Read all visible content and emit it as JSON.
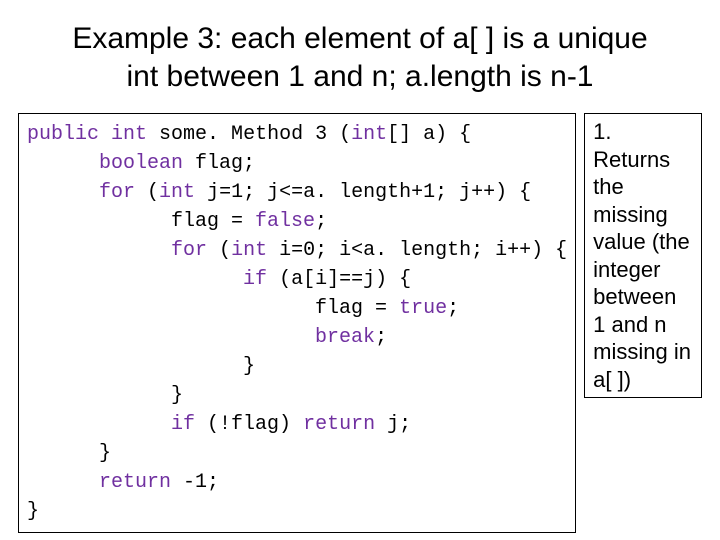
{
  "title_line1": "Example 3: each element of a[ ] is a unique",
  "title_line2": "int between 1 and n; a.length is n-1",
  "code": {
    "l1a": "public",
    "l1b": " ",
    "l1c": "int",
    "l1d": " some. Method 3 (",
    "l1e": "int",
    "l1f": "[] a) {",
    "l2a": "      ",
    "l2b": "boolean",
    "l2c": " flag;",
    "l3a": "      ",
    "l3b": "for",
    "l3c": " (",
    "l3d": "int",
    "l3e": " j=1; j<=a. length+1; j++) {",
    "l4": "            flag = ",
    "l4b": "false",
    "l4c": ";",
    "l5a": "            ",
    "l5b": "for",
    "l5c": " (",
    "l5d": "int",
    "l5e": " i=0; i<a. length; i++) {",
    "l6a": "                  ",
    "l6b": "if",
    "l6c": " (a[i]==j) {",
    "l7": "                        flag = ",
    "l7b": "true",
    "l7c": ";",
    "l8a": "                        ",
    "l8b": "break",
    "l8c": ";",
    "l9": "                  }",
    "l10": "            }",
    "l11a": "            ",
    "l11b": "if",
    "l11c": " (!flag) ",
    "l11d": "return",
    "l11e": " j;",
    "l12": "      }",
    "l13a": "      ",
    "l13b": "return",
    "l13c": " -1;",
    "l14": "}"
  },
  "note": "1. Returns the missing value (the integer between 1 and n missing in a[ ])"
}
